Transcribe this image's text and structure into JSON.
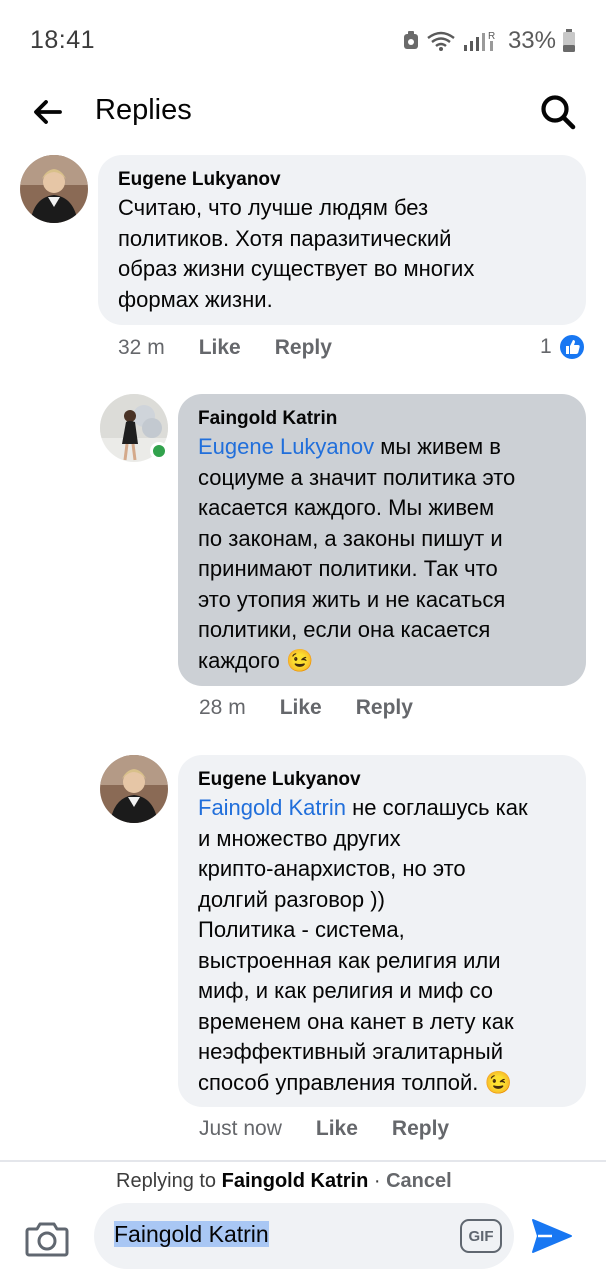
{
  "status": {
    "time": "18:41",
    "battery": "33%"
  },
  "header": {
    "title": "Replies"
  },
  "comments": [
    {
      "author": "Eugene Lukyanov",
      "mention": "",
      "text": "Считаю, что лучше людям без\nполитиков. Хотя паразитический\nобраз жизни существует во многих\nформах жизни.",
      "time": "32 m",
      "like_label": "Like",
      "reply_label": "Reply",
      "reaction_count": "1"
    },
    {
      "author": "Faingold Katrin",
      "mention": "Eugene Lukyanov",
      "text": " мы живем в\nсоциуме а значит политика это\nкасается каждого. Мы живем\nпо законам, а законы пишут и\nпринимают политики. Так что\nэто утопия жить и не касаться\nполитики, если она касается\nкаждого 😉",
      "time": "28 m",
      "like_label": "Like",
      "reply_label": "Reply"
    },
    {
      "author": "Eugene Lukyanov",
      "mention": "Faingold Katrin",
      "text": " не соглашусь как\nи множество других\nкрипто-анархистов, но это\nдолгий разговор ))\nПолитика - система,\nвыстроенная как религия или\nмиф, и как религия и миф со\nвременем она канет в лету как\nнеэффективный эгалитарный\nспособ управления толпой. 😉",
      "time": "Just now",
      "like_label": "Like",
      "reply_label": "Reply"
    }
  ],
  "reply_bar": {
    "prefix": "Replying to ",
    "name": "Faingold Katrin",
    "separator": " · ",
    "cancel": "Cancel"
  },
  "composer": {
    "value": "Faingold Katrin",
    "gif_label": "GIF"
  },
  "icons": {
    "back": "arrow-left-icon",
    "search": "search-icon",
    "like_reaction": "thumbs-up-icon",
    "camera": "camera-icon",
    "send": "send-icon"
  },
  "colors": {
    "mention": "#216fdb",
    "bubble": "#f0f2f5",
    "highlight_bubble": "#ccd0d5",
    "accent": "#1877f2",
    "online": "#31a24c"
  }
}
